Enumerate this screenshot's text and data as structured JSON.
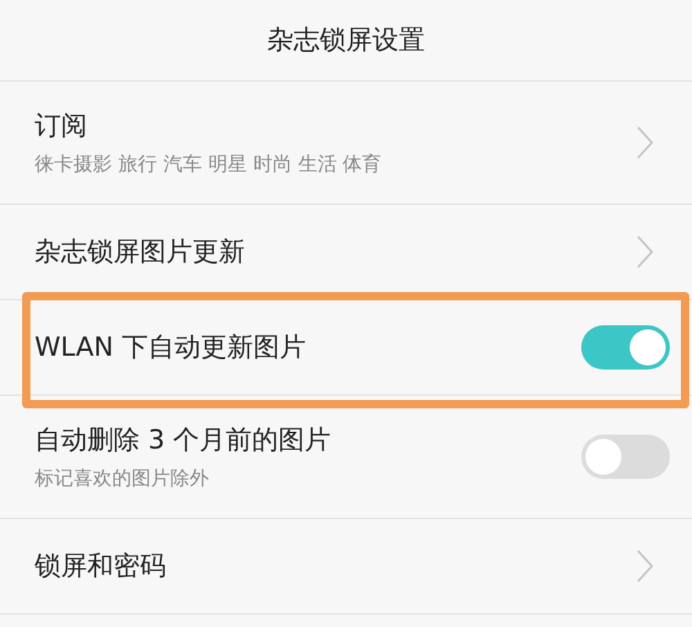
{
  "header": {
    "title": "杂志锁屏设置"
  },
  "rows": [
    {
      "kind": "link",
      "title": "订阅",
      "subtitle": "徕卡摄影 旅行 汽车 明星 时尚 生活 体育",
      "highlighted": false
    },
    {
      "kind": "link",
      "title": "杂志锁屏图片更新",
      "highlighted": false
    },
    {
      "kind": "toggle",
      "title": "WLAN 下自动更新图片",
      "on": true,
      "highlighted": true
    },
    {
      "kind": "toggle",
      "title": "自动删除 3 个月前的图片",
      "subtitle": "标记喜欢的图片除外",
      "on": false,
      "highlighted": false
    },
    {
      "kind": "link",
      "title": "锁屏和密码",
      "highlighted": false
    }
  ]
}
